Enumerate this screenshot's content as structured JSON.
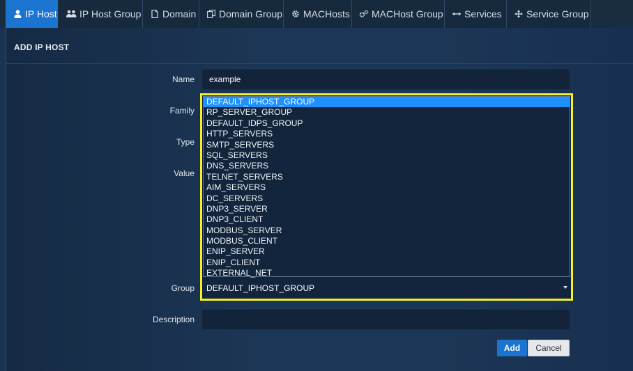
{
  "tabs": [
    {
      "label": "IP Host",
      "icon": "user-icon",
      "active": true
    },
    {
      "label": "IP Host Group",
      "icon": "users-icon"
    },
    {
      "label": "Domain",
      "icon": "file-icon"
    },
    {
      "label": "Domain Group",
      "icon": "copy-icon"
    },
    {
      "label": "MACHosts",
      "icon": "gear-icon"
    },
    {
      "label": "MACHost Group",
      "icon": "gears-icon"
    },
    {
      "label": "Services",
      "icon": "arrows-h-icon"
    },
    {
      "label": "Service Group",
      "icon": "arrows-move-icon"
    }
  ],
  "form": {
    "title": "ADD IP HOST",
    "name_label": "Name",
    "name_value": "example",
    "family_label": "Family",
    "type_label": "Type",
    "value_label": "Value",
    "group_label": "Group",
    "group_selected": "DEFAULT_IPHOST_GROUP",
    "group_options": [
      "DEFAULT_IPHOST_GROUP",
      "RP_SERVER_GROUP",
      "DEFAULT_IDPS_GROUP",
      "HTTP_SERVERS",
      "SMTP_SERVERS",
      "SQL_SERVERS",
      "DNS_SERVERS",
      "TELNET_SERVERS",
      "AIM_SERVERS",
      "DC_SERVERS",
      "DNP3_SERVER",
      "DNP3_CLIENT",
      "MODBUS_SERVER",
      "MODBUS_CLIENT",
      "ENIP_SERVER",
      "ENIP_CLIENT",
      "EXTERNAL_NET"
    ],
    "description_label": "Description",
    "description_value": "",
    "add_label": "Add",
    "cancel_label": "Cancel"
  },
  "colors": {
    "accent": "#1b74cf",
    "highlight": "#f4ef2a",
    "selected_option": "#1e90ff"
  }
}
